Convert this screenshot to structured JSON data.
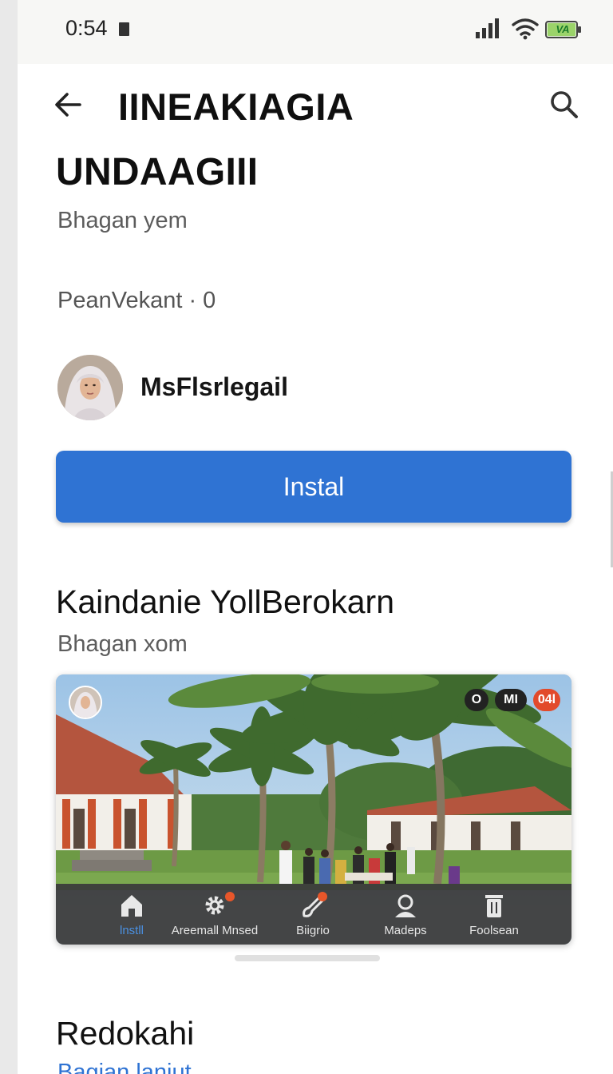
{
  "status_bar": {
    "time": "0:54",
    "battery_label": "VA"
  },
  "top_bar": {
    "title": "IINEAKIAGIA"
  },
  "app": {
    "subtitle": "UNDAAGIII",
    "developer": "Bhagan yem",
    "meta": "PeanVekant · 0",
    "publisher_name": "MsFlsrlegail",
    "install_label": "Instal"
  },
  "section": {
    "title": "Kaindanie YollBerokarn",
    "subtitle": "Bhagan xom"
  },
  "preview": {
    "chips": [
      "O",
      "MI",
      "04l"
    ],
    "nav": [
      {
        "label": "lnstll",
        "icon": "home-icon",
        "active": true
      },
      {
        "label": "Areemall Mnsed",
        "icon": "gear-icon",
        "active": false
      },
      {
        "label": "Biigrio",
        "icon": "brush-icon",
        "active": false
      },
      {
        "label": "Madeps",
        "icon": "person-icon",
        "active": false
      },
      {
        "label": "Foolsean",
        "icon": "trash-icon",
        "active": false
      }
    ]
  },
  "section2": {
    "title": "Redokahi",
    "subtitle": "Bagian lanjut"
  },
  "colors": {
    "accent": "#2f73d3",
    "nav_active": "#4a90e2",
    "badge": "#e24a2b"
  }
}
